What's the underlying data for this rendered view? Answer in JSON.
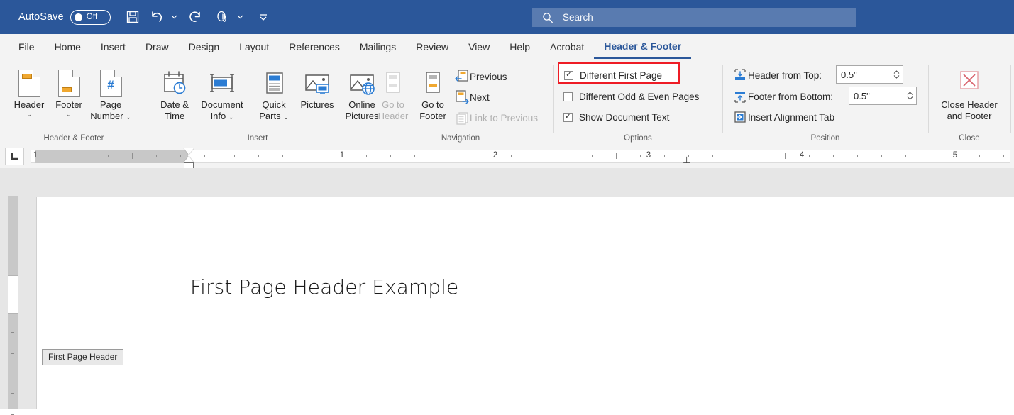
{
  "titlebar": {
    "autosave_label": "AutoSave",
    "autosave_state": "Off",
    "buttons": [
      {
        "name": "save-button",
        "icon": "save-icon"
      },
      {
        "name": "undo-button",
        "icon": "undo-icon"
      },
      {
        "name": "undo-dropdown",
        "icon": "chevron-down-icon"
      },
      {
        "name": "redo-button",
        "icon": "redo-icon"
      },
      {
        "name": "touch-mode-button",
        "icon": "touch-hand-icon"
      },
      {
        "name": "touch-dropdown",
        "icon": "chevron-down-icon"
      },
      {
        "name": "customize-qat-button",
        "icon": "chevron-down-bar-icon"
      }
    ],
    "accent_color": "#2b579a"
  },
  "search": {
    "placeholder": "Search",
    "icon": "search-icon"
  },
  "tabs": [
    {
      "label": "File",
      "active": false
    },
    {
      "label": "Home",
      "active": false
    },
    {
      "label": "Insert",
      "active": false
    },
    {
      "label": "Draw",
      "active": false
    },
    {
      "label": "Design",
      "active": false
    },
    {
      "label": "Layout",
      "active": false
    },
    {
      "label": "References",
      "active": false
    },
    {
      "label": "Mailings",
      "active": false
    },
    {
      "label": "Review",
      "active": false
    },
    {
      "label": "View",
      "active": false
    },
    {
      "label": "Help",
      "active": false
    },
    {
      "label": "Acrobat",
      "active": false
    },
    {
      "label": "Header & Footer",
      "active": true
    }
  ],
  "ribbon": {
    "groups": [
      {
        "name": "header-and-footer",
        "label": "Header & Footer"
      },
      {
        "name": "insert",
        "label": "Insert"
      },
      {
        "name": "navigation",
        "label": "Navigation"
      },
      {
        "name": "options",
        "label": "Options"
      },
      {
        "name": "position",
        "label": "Position"
      },
      {
        "name": "close",
        "label": "Close"
      }
    ],
    "header_footer": {
      "header": {
        "line1": "Header",
        "caret": "⌄"
      },
      "footer": {
        "line1": "Footer",
        "caret": "⌄"
      },
      "page_number": {
        "line1": "Page",
        "line2": "Number",
        "caret": "⌄"
      }
    },
    "insert": {
      "date_time": {
        "line1": "Date &",
        "line2": "Time"
      },
      "document_info": {
        "line1": "Document",
        "line2": "Info",
        "caret": "⌄"
      },
      "quick_parts": {
        "line1": "Quick",
        "line2": "Parts",
        "caret": "⌄"
      },
      "pictures": {
        "line1": "Pictures"
      },
      "online_pictures": {
        "line1": "Online",
        "line2": "Pictures"
      }
    },
    "navigation": {
      "go_to_header": {
        "line1": "Go to",
        "line2": "Header",
        "disabled": true
      },
      "go_to_footer": {
        "line1": "Go to",
        "line2": "Footer",
        "disabled": false
      },
      "previous": {
        "label": "Previous",
        "disabled": false
      },
      "next": {
        "label": "Next",
        "disabled": false
      },
      "link_to_previous": {
        "label": "Link to Previous",
        "disabled": true
      }
    },
    "options": {
      "different_first_page": {
        "label": "Different First Page",
        "checked": true,
        "highlight_color": "#ee1c25"
      },
      "different_odd_even": {
        "label": "Different Odd & Even Pages",
        "checked": false
      },
      "show_document_text": {
        "label": "Show Document Text",
        "checked": true
      }
    },
    "position": {
      "header_from_top": {
        "label": "Header from Top:",
        "value": "0.5\""
      },
      "footer_from_bottom": {
        "label": "Footer from Bottom:",
        "value": "0.5\""
      },
      "insert_alignment_tab": {
        "label": "Insert Alignment Tab"
      }
    },
    "close": {
      "close_header_footer": {
        "line1": "Close Header",
        "line2": "and Footer"
      }
    }
  },
  "ruler": {
    "tab_selector_icon": "left-tab-stop-icon",
    "numbers": [
      "1",
      "1",
      "2",
      "3",
      "4",
      "5"
    ],
    "tab_stop_marker": "⊥"
  },
  "document": {
    "header_text": "First Page Header Example",
    "header_tag": "First Page Header"
  }
}
